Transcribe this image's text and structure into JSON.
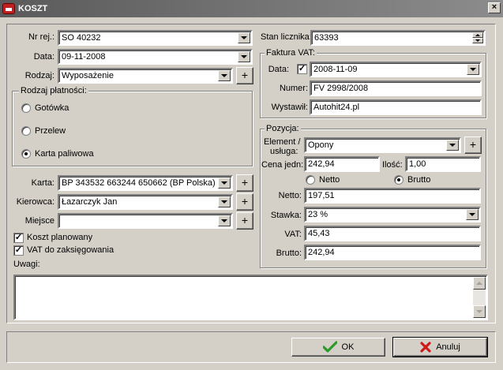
{
  "window": {
    "title": "KOSZT",
    "close_label": "×"
  },
  "left": {
    "nr_rej": {
      "label": "Nr rej.:",
      "value": "SO 40232"
    },
    "data": {
      "label": "Data:",
      "value": "09-11-2008"
    },
    "rodzaj": {
      "label": "Rodzaj:",
      "value": "Wyposażenie"
    },
    "payment": {
      "title": "Rodzaj płatności:",
      "options": [
        {
          "label": "Gotówka",
          "selected": false
        },
        {
          "label": "Przelew",
          "selected": false
        },
        {
          "label": "Karta paliwowa",
          "selected": true
        }
      ]
    },
    "karta": {
      "label": "Karta:",
      "value": "BP 343532 663244 650662 (BP Polska)"
    },
    "kierowca": {
      "label": "Kierowca:",
      "value": "Łazarczyk Jan"
    },
    "miejsce": {
      "label": "Miejsce",
      "value": ""
    },
    "koszt_planowany": {
      "label": "Koszt planowany",
      "checked": true
    },
    "vat_do_zaksiegowania": {
      "label": "VAT do zaksięgowania",
      "checked": true
    },
    "uwagi": {
      "label": "Uwagi:",
      "value": ""
    }
  },
  "right": {
    "stan_licznika": {
      "label": "Stan licznika:",
      "value": "63393"
    },
    "faktura": {
      "title": "Faktura VAT:",
      "data": {
        "label": "Data:",
        "value": "2008-11-09",
        "checked": true
      },
      "numer": {
        "label": "Numer:",
        "value": "FV 2998/2008"
      },
      "wystawil": {
        "label": "Wystawił:",
        "value": "Autohit24.pl"
      }
    },
    "pozycja": {
      "title": "Pozycja:",
      "element": {
        "label_line1": "Element /",
        "label_line2": "usługa:",
        "value": "Opony"
      },
      "cena_jedn": {
        "label": "Cena jedn:",
        "value": "242,94"
      },
      "ilosc": {
        "label": "Ilość:",
        "value": "1,00"
      },
      "mode": [
        {
          "label": "Netto",
          "selected": false
        },
        {
          "label": "Brutto",
          "selected": true
        }
      ],
      "netto": {
        "label": "Netto:",
        "value": "197,51"
      },
      "stawka": {
        "label": "Stawka:",
        "value": "23 %"
      },
      "vat": {
        "label": "VAT:",
        "value": "45,43"
      },
      "brutto": {
        "label": "Brutto:",
        "value": "242,94"
      }
    }
  },
  "buttons": {
    "plus": "+",
    "ok": {
      "label": "OK",
      "icon": "checkmark-icon",
      "color": "#2a9a2a"
    },
    "cancel": {
      "label": "Anuluj",
      "icon": "x-icon",
      "color": "#cc1a1a"
    }
  },
  "colors": {
    "dialog_bg": "#d4d0c8",
    "title_bg": "#6e6e6e"
  }
}
